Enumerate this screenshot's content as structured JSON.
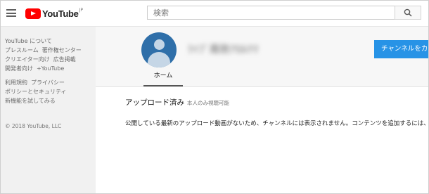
{
  "header": {
    "logo_text": "YouTube",
    "logo_region": "JP",
    "search_placeholder": "検索",
    "search_icon": "magnifier"
  },
  "sidebar": {
    "rows": [
      [
        "YouTube について"
      ],
      [
        "プレスルーム",
        "著作権センター"
      ],
      [
        "クリエイター向け",
        "広告掲載"
      ],
      [
        "開発者向け",
        "+YouTube"
      ],
      [
        "利用規約",
        "プライバシー"
      ],
      [
        "ポリシーとセキュリティ"
      ],
      [
        "新機能を試してみる"
      ]
    ],
    "copyright": "© 2018 YouTube, LLC"
  },
  "channel": {
    "name": "ﾗｲﾌﾞ周防ｱﾛﾙｸﾏ",
    "customize_label": "チャンネルをカスタマイズ",
    "tabs": [
      "ホーム"
    ]
  },
  "content": {
    "section_title": "アップロード済み",
    "section_sub": "本人のみ視聴可能",
    "empty_message": "公開している最新のアップロード動画がないため、チャンネルには表示されません。コンテンツを追加するには、"
  },
  "colors": {
    "accent": "#2793e6",
    "logo_red": "#ff0000",
    "avatar_bg": "#2f6fa9"
  }
}
